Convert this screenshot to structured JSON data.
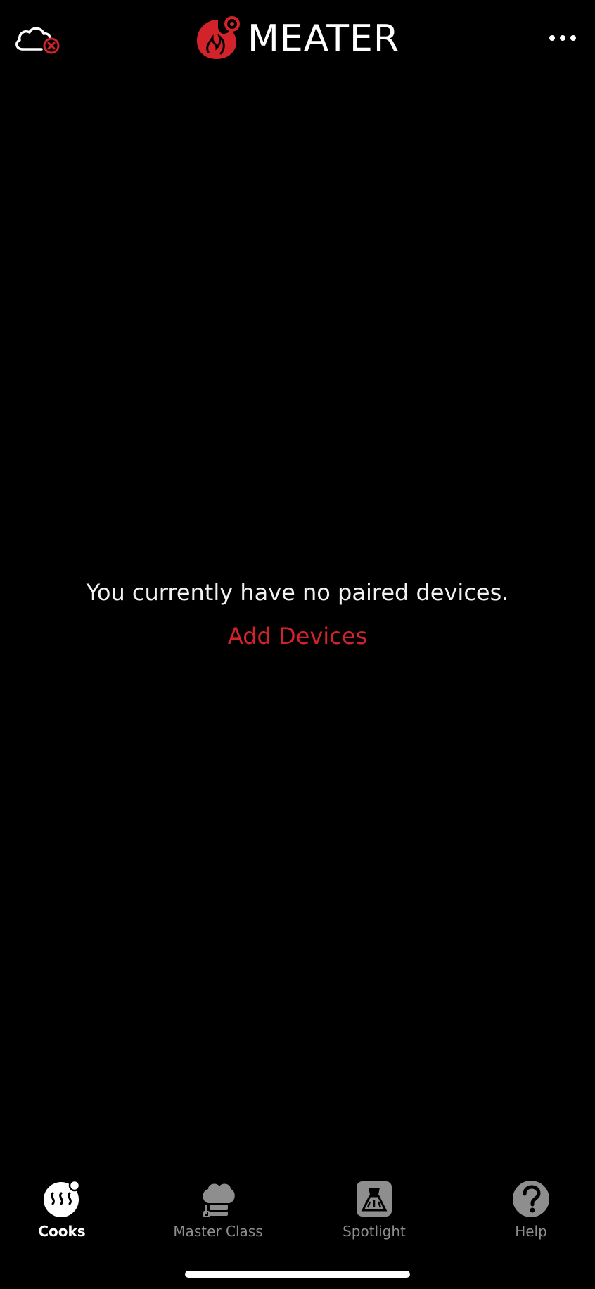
{
  "header": {
    "brand": "MEATER",
    "cloud_icon": "cloud-disconnected-icon",
    "more_icon": "more-icon"
  },
  "empty_state": {
    "message": "You currently have no paired devices.",
    "action_label": "Add Devices"
  },
  "tabs": [
    {
      "label": "Cooks",
      "icon": "cooks-icon",
      "active": true
    },
    {
      "label": "Master Class",
      "icon": "chef-hat-icon",
      "active": false
    },
    {
      "label": "Spotlight",
      "icon": "spotlight-icon",
      "active": false
    },
    {
      "label": "Help",
      "icon": "help-icon",
      "active": false
    }
  ],
  "colors": {
    "background": "#000000",
    "accent": "#d2232a",
    "text": "#ffffff",
    "tab_inactive": "#8e8e8e"
  }
}
